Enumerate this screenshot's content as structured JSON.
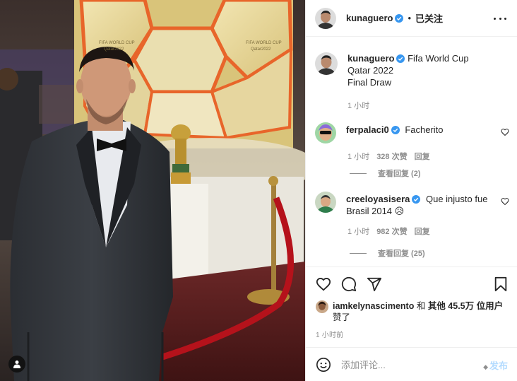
{
  "post": {
    "author": "kunaguero",
    "follow_state": "已关注",
    "separator": "•",
    "more_icon": "more-horizontal-icon",
    "caption_text": "Fifa World Cup\nQatar 2022\nFinal Draw",
    "caption_time": "1 小时",
    "photo_tags": {
      "top_left": "FIFA WORLD CUP",
      "top_left_sub": "Qatar2022",
      "top_right": "FIFA WORLD CUP",
      "top_right_sub": "Qatar2022"
    }
  },
  "comments": [
    {
      "user": "ferpalaci0",
      "verified": true,
      "text": "Facherito",
      "time": "1 小时",
      "likes": "328 次赞",
      "reply": "回复",
      "view_replies": "查看回复 (2)"
    },
    {
      "user": "creeloyasisera",
      "verified": true,
      "text": "Que injusto fue Brasil 2014 😥",
      "time": "1 小时",
      "likes": "982 次赞",
      "reply": "回复",
      "view_replies": "查看回复 (25)"
    }
  ],
  "likes": {
    "user": "iamkelynascimento",
    "conj": "和",
    "others": "其他 45.5万 位用户",
    "suffix": "赞了"
  },
  "time_ago": "1 小时前",
  "composer": {
    "placeholder": "添加评论...",
    "post_label": "发布",
    "emoji_icon": "emoji-icon"
  },
  "colors": {
    "verified_blue": "#3897f0",
    "post_disabled": "#b3dbff",
    "muted": "#8e8e8e",
    "rope_red": "#b5121b"
  }
}
